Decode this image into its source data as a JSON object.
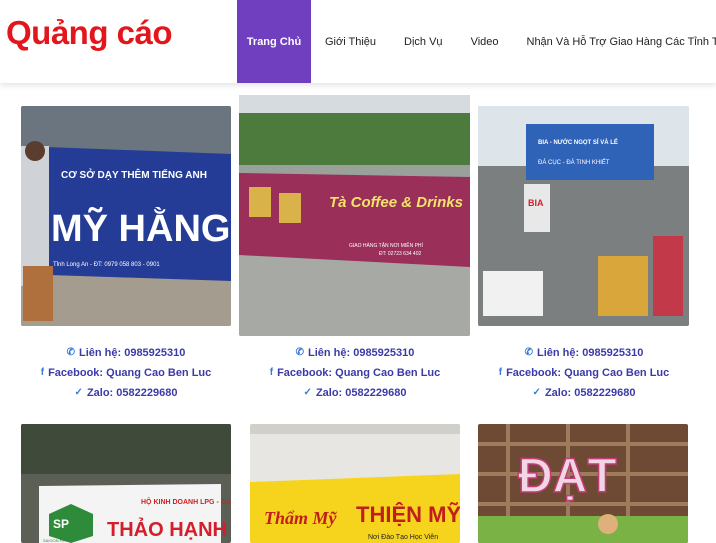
{
  "brand": {
    "logo_text": "Quảng cáo",
    "logo_color": "#e3161b"
  },
  "nav": {
    "active_color": "#6f3fc0",
    "items": [
      {
        "label": "Trang Chủ",
        "active": true
      },
      {
        "label": "Giới Thiệu"
      },
      {
        "label": "Dịch Vụ"
      },
      {
        "label": "Video"
      },
      {
        "label": "Nhận Và Hỗ Trợ Giao Hàng Các Tỉnh Thành"
      }
    ]
  },
  "cards": [
    {
      "sign": {
        "line1": "CƠ SỞ DẠY THÊM TIẾNG ANH",
        "line2": "MỸ HẰNG",
        "line3": "Tỉnh Long An - ĐT: 0979 058 803 - 0901"
      },
      "contact": {
        "phone": "Liên hệ: 0985925310",
        "facebook": "Facebook: Quang Cao Ben Luc",
        "zalo": "Zalo: 0582229680"
      }
    },
    {
      "sign": {
        "line1": "Tà Coffee & Drinks",
        "line2": "GIAO HÀNG TẬN NƠI MIỄN PHÍ",
        "line3": "ĐT: 02723 634 402"
      },
      "contact": {
        "phone": "Liên hệ: 0985925310",
        "facebook": "Facebook: Quang Cao Ben Luc",
        "zalo": "Zalo: 0582229680"
      }
    },
    {
      "sign": {
        "line1": "BIA - NƯỚC NGỌT SỈ VÀ LẺ",
        "line2": "ĐÁ CỤC - ĐÁ TINH KHIẾT",
        "line3": "BIA"
      },
      "contact": {
        "phone": "Liên hệ: 0985925310",
        "facebook": "Facebook: Quang Cao Ben Luc",
        "zalo": "Zalo: 0582229680"
      }
    },
    {
      "sign": {
        "line1": "HỘ KINH DOANH LPG - GAS",
        "line2": "THẢO HẠNH",
        "line3": "SAIGON PETRO"
      }
    },
    {
      "sign": {
        "line1": "Thẩm Mỹ",
        "line2": "THIỆN MỸ",
        "line3": "Nơi Đào Tạo Học Viên"
      }
    },
    {
      "sign": {
        "line1": "ĐẠT",
        "line2": "",
        "line3": ""
      }
    }
  ]
}
